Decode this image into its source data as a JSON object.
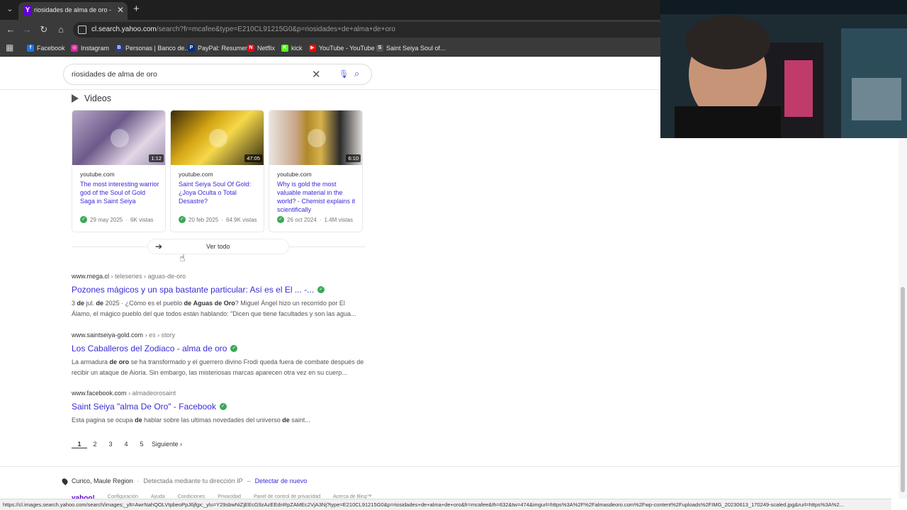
{
  "browser": {
    "tab_title": "riosidades de alma de oro - Yah",
    "tab_favicon": "Y",
    "url_host": "cl.search.yahoo.com",
    "url_path": "/search?fr=mcafee&type=E210CL91215G0&p=riosidades+de+alma+de+oro",
    "bookmarks": [
      {
        "label": "Facebook",
        "icon": "facebook-icon",
        "color": "#1877f2",
        "glyph": "f"
      },
      {
        "label": "Instagram",
        "icon": "instagram-icon",
        "color": "#d6249f",
        "glyph": "◎"
      },
      {
        "label": "Personas | Banco de...",
        "icon": "bank-icon",
        "color": "#2a3b8f",
        "glyph": "B"
      },
      {
        "label": "PayPal: Resumen",
        "icon": "paypal-icon",
        "color": "#003087",
        "glyph": "P"
      },
      {
        "label": "Netflix",
        "icon": "netflix-icon",
        "color": "#e50914",
        "glyph": "N"
      },
      {
        "label": "kick",
        "icon": "kick-icon",
        "color": "#53fc18",
        "glyph": "K"
      },
      {
        "label": "YouTube - YouTube",
        "icon": "youtube-icon",
        "color": "#ff0000",
        "glyph": "▶"
      },
      {
        "label": "Saint Seiya Soul of...",
        "icon": "saint-seiya-icon",
        "color": "#555555",
        "glyph": "S"
      }
    ]
  },
  "search": {
    "query": "riosidades de alma de oro"
  },
  "videos": {
    "section_title": "Videos",
    "items": [
      {
        "source": "youtube.com",
        "title": "The most interesting warrior god of the Soul of Gold Saga in Saint Seiya",
        "date": "29 may 2025",
        "views": "6K vistas",
        "duration": "1:12"
      },
      {
        "source": "youtube.com",
        "title": "Saint Seiya Soul Of Gold: ¿Joya Oculta o Total Desastre?",
        "date": "20 feb 2025",
        "views": "64.9K vistas",
        "duration": "47:05"
      },
      {
        "source": "youtube.com",
        "title": "Why is gold the most valuable material in the world? - Chemist explains it scientifically",
        "date": "26 oct 2024",
        "views": "1.4M vistas",
        "duration": "6:10"
      }
    ],
    "see_all": "Ver todo"
  },
  "results": [
    {
      "host": "www.mega.cl",
      "crumb": "› teleseries › aguas-de-oro",
      "title": "Pozones mágicos y un spa bastante particular: Así es el El ... -...",
      "snippet_html": "3 <b>de</b> jul. <b>de</b> 2025 · ¿Cómo es el pueblo <b>de</b> <b>Aguas</b> <b>de</b> <b>Oro</b>? Miguel Ángel hizo un recorrido por El Álamo, el mágico pueblo del que todos están hablando: \"Dicen que tiene facultades y son las agua..."
    },
    {
      "host": "www.saintseiya-gold.com",
      "crumb": "› es › story",
      "title": "Los Caballeros del Zodiaco - alma de oro",
      "snippet_html": "La armadura <b>de</b> <b>oro</b> se ha transformado y el guerrero divino Frodi queda fuera de combate después de recibir un ataque de Aioria. Sin embargo, las misteriosas marcas aparecen otra vez en su cuerp..."
    },
    {
      "host": "www.facebook.com",
      "crumb": "› almadeorosaint",
      "title": "Saint Seiya \"alma De Oro\" - Facebook",
      "snippet_html": "Esta pagina se ocupa <b>de</b> hablar sobre las ultimas novedades del universo <b>de</b> saint..."
    }
  ],
  "pagination": {
    "pages": [
      "1",
      "2",
      "3",
      "4",
      "5"
    ],
    "current": "1",
    "next": "Siguiente"
  },
  "footer": {
    "location": "Curico, Maule Region",
    "location_note": "Detectada mediante tu dirección IP",
    "detect_again": "Detectar de nuevo",
    "brand": "yahoo!",
    "links": [
      "Configuración",
      "Ayuda",
      "Condiciones",
      "Privacidad",
      "Panel de control de privacidad",
      "Acerca de Bing™"
    ]
  },
  "status_url": "https://cl.images.search.yahoo.com/search/images;_ylt=AwrNahQOLVtpbeoPpJ6jfgx;_ylu=Y29sbwNiZjEEcG9zAzEEdnRpZAMEc2VjA3Nj?type=E210CL91215G0&p=riosidades+de+alma+de+oro&fr=mcafee&th=632&tw=474&imgurl=https%3A%2F%2Falmasdeoro.com%2Fwp-content%2Fuploads%2FIMG_20230613_170249-scaled.jpg&rurl=https%3A%2..."
}
